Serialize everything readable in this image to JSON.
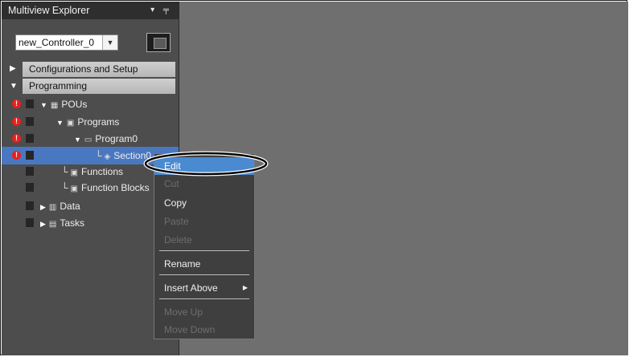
{
  "panel": {
    "title": "Multiview Explorer",
    "header_icons": "▾ ╤"
  },
  "controller_select": {
    "value": "new_Controller_0",
    "arrow": "▼"
  },
  "sections": [
    {
      "label": "Configurations and Setup",
      "arrow": "▶"
    },
    {
      "label": "Programming",
      "arrow": "▼"
    }
  ],
  "tree": [
    {
      "label": "POUs",
      "toggle": "▼",
      "icon": "▦",
      "error": true
    },
    {
      "label": "Programs",
      "toggle": "▼",
      "icon": "▣",
      "error": true
    },
    {
      "label": "Program0",
      "toggle": "▼",
      "icon": "▭",
      "error": true
    },
    {
      "label": "Section0",
      "elbow": "└",
      "icon": "◈",
      "error": true,
      "selected": true
    },
    {
      "label": "Functions",
      "elbow": "└",
      "icon": "▣",
      "error": false
    },
    {
      "label": "Function Blocks",
      "elbow": "└",
      "icon": "▣",
      "error": false
    },
    {
      "label": "Data",
      "toggle": "▶",
      "icon": "▥",
      "error": false
    },
    {
      "label": "Tasks",
      "toggle": "▶",
      "icon": "▤",
      "error": false
    }
  ],
  "error_glyph": "!",
  "context_menu": {
    "items": [
      {
        "label": "Edit",
        "enabled": true,
        "highlighted": true
      },
      {
        "label": "Cut",
        "enabled": false
      },
      {
        "label": "Copy",
        "enabled": true
      },
      {
        "label": "Paste",
        "enabled": false
      },
      {
        "label": "Delete",
        "enabled": false
      },
      {
        "label": "Rename",
        "enabled": true
      },
      {
        "label": "Insert Above",
        "enabled": true,
        "submenu_arrow": "▶"
      },
      {
        "label": "Move Up",
        "enabled": false
      },
      {
        "label": "Move Down",
        "enabled": false
      }
    ]
  }
}
